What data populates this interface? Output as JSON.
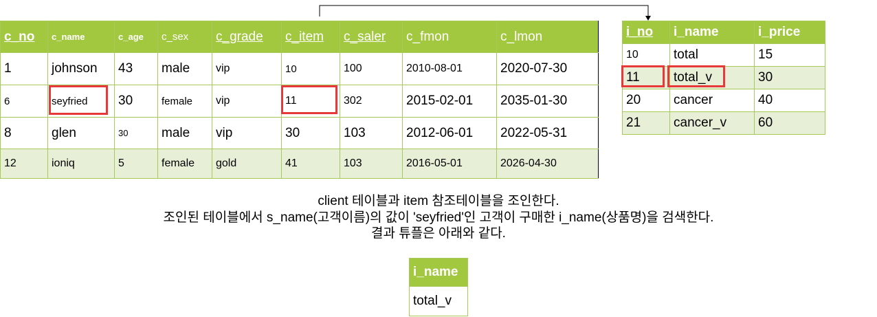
{
  "client_table": {
    "columns": [
      "c_no",
      "c_name",
      "c_age",
      "c_sex",
      "c_grade",
      "c_item",
      "c_saler",
      "c_fmon",
      "c_lmon"
    ],
    "rows": [
      [
        "1",
        "johnson",
        "43",
        "male",
        "vip",
        "10",
        "100",
        "2010-08-01",
        "2020-07-30"
      ],
      [
        "6",
        "seyfried",
        "30",
        "female",
        "vip",
        "11",
        "302",
        "2015-02-01",
        "2035-01-30"
      ],
      [
        "8",
        "glen",
        "30",
        "male",
        "vip",
        "30",
        "103",
        "2012-06-01",
        "2022-05-31"
      ],
      [
        "12",
        "ioniq",
        "5",
        "female",
        "gold",
        "41",
        "103",
        "2016-05-01",
        "2026-04-30"
      ]
    ]
  },
  "item_table": {
    "columns": [
      "i_no",
      "i_name",
      "i_price"
    ],
    "rows": [
      [
        "10",
        "total",
        "15"
      ],
      [
        "11",
        "total_v",
        "30"
      ],
      [
        "20",
        "cancer",
        "40"
      ],
      [
        "21",
        "cancer_v",
        "60"
      ]
    ]
  },
  "description": {
    "line1": "client 테이블과 item 참조테이블을 조인한다.",
    "line2": "조인된 테이블에서 s_name(고객이름)의 값이 'seyfried'인 고객이 구매한 i_name(상품명)을 검색한다.",
    "line3": "결과 튜플은 아래와 같다."
  },
  "result_table": {
    "columns": [
      "i_name"
    ],
    "rows": [
      [
        "total_v"
      ]
    ]
  },
  "colors": {
    "header_bg": "#a2c83f",
    "header_text": "#ffffff",
    "row_shade": "#e7f0d6",
    "grid": "#a6c95a",
    "highlight": "#e8393a"
  }
}
